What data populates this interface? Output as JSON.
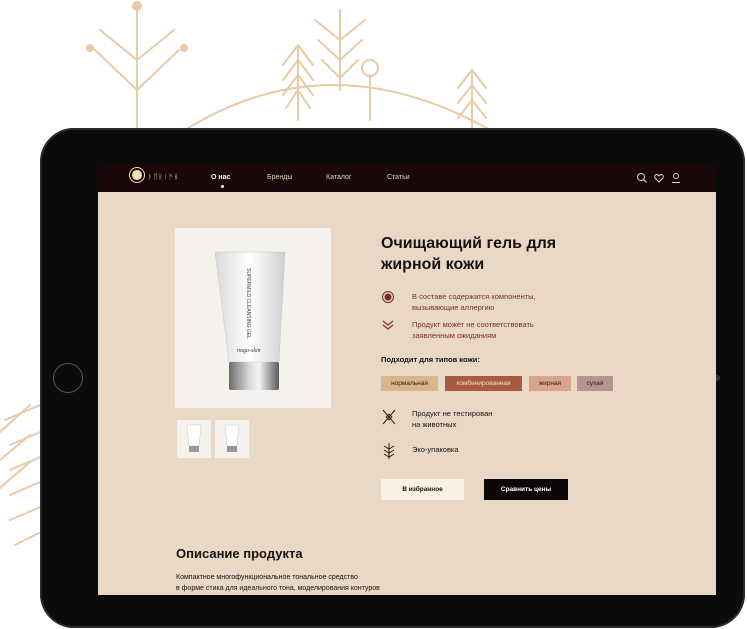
{
  "colors": {
    "decor": "#e7cba6",
    "tablet_bezel": "#0b0b0b",
    "page_bg": "#ead8c7",
    "nav_bg": "#1a0808",
    "accent_red": "#7a2c2c",
    "chip_normal": "#d9b58a",
    "chip_combined": "#a85b40",
    "chip_oily": "#d8a48d",
    "chip_dry": "#b49592"
  },
  "nav": {
    "logo_text": "ᚦᛖᚱᛁᚫᚺ",
    "items": [
      {
        "label": "О нас",
        "active": true
      },
      {
        "label": "Бренды"
      },
      {
        "label": "Каталог"
      },
      {
        "label": "Статьи"
      }
    ],
    "icons": [
      "search-icon",
      "heart-icon",
      "user-icon"
    ]
  },
  "product": {
    "title_line1": "Очищающий гель для",
    "title_line2": "жирной кожи",
    "tube_brand": "noga-skin",
    "tube_text": "SUPERMILD CLEANSING GEL",
    "warnings": [
      {
        "icon": "allergen-icon",
        "line1": "В составе содержатся компоненты,",
        "line2": "вызывающие аллергию"
      },
      {
        "icon": "double-chevron-icon",
        "line1": "Продукт может не соответствовать",
        "line2": "заявленным ожиданиям"
      }
    ],
    "skin_types_title": "Подходит для типов кожи:",
    "skin_types": [
      "нормальная",
      "комбинированная",
      "жирная",
      "сухая"
    ],
    "features": [
      {
        "icon": "not-tested-icon",
        "line1": "Продукт не тестирован",
        "line2": "на животных"
      },
      {
        "icon": "eco-icon",
        "line1": "Эко-упаковка",
        "line2": ""
      }
    ],
    "favorite_label": "В избранное",
    "compare_label": "Сравнить цены"
  },
  "description": {
    "title": "Описание продукта",
    "line1": "Компактное многофункциональное тональное средство",
    "line2": "в форме стика для идеального тона, моделирования контуров"
  }
}
